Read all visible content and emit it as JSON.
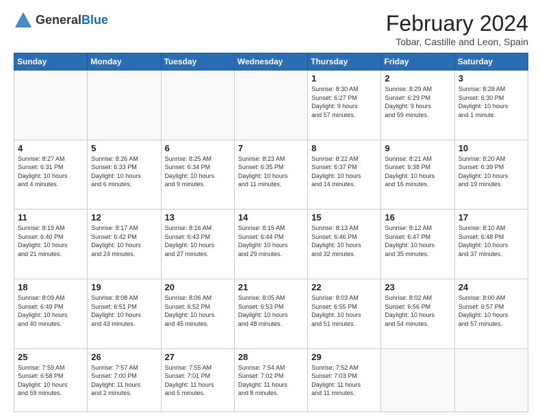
{
  "header": {
    "logo_general": "General",
    "logo_blue": "Blue",
    "month_title": "February 2024",
    "location": "Tobar, Castille and Leon, Spain"
  },
  "days_of_week": [
    "Sunday",
    "Monday",
    "Tuesday",
    "Wednesday",
    "Thursday",
    "Friday",
    "Saturday"
  ],
  "weeks": [
    [
      {
        "day": "",
        "info": ""
      },
      {
        "day": "",
        "info": ""
      },
      {
        "day": "",
        "info": ""
      },
      {
        "day": "",
        "info": ""
      },
      {
        "day": "1",
        "info": "Sunrise: 8:30 AM\nSunset: 6:27 PM\nDaylight: 9 hours\nand 57 minutes."
      },
      {
        "day": "2",
        "info": "Sunrise: 8:29 AM\nSunset: 6:29 PM\nDaylight: 9 hours\nand 59 minutes."
      },
      {
        "day": "3",
        "info": "Sunrise: 8:28 AM\nSunset: 6:30 PM\nDaylight: 10 hours\nand 1 minute."
      }
    ],
    [
      {
        "day": "4",
        "info": "Sunrise: 8:27 AM\nSunset: 6:31 PM\nDaylight: 10 hours\nand 4 minutes."
      },
      {
        "day": "5",
        "info": "Sunrise: 8:26 AM\nSunset: 6:33 PM\nDaylight: 10 hours\nand 6 minutes."
      },
      {
        "day": "6",
        "info": "Sunrise: 8:25 AM\nSunset: 6:34 PM\nDaylight: 10 hours\nand 9 minutes."
      },
      {
        "day": "7",
        "info": "Sunrise: 8:23 AM\nSunset: 6:35 PM\nDaylight: 10 hours\nand 11 minutes."
      },
      {
        "day": "8",
        "info": "Sunrise: 8:22 AM\nSunset: 6:37 PM\nDaylight: 10 hours\nand 14 minutes."
      },
      {
        "day": "9",
        "info": "Sunrise: 8:21 AM\nSunset: 6:38 PM\nDaylight: 10 hours\nand 16 minutes."
      },
      {
        "day": "10",
        "info": "Sunrise: 8:20 AM\nSunset: 6:39 PM\nDaylight: 10 hours\nand 19 minutes."
      }
    ],
    [
      {
        "day": "11",
        "info": "Sunrise: 8:19 AM\nSunset: 6:40 PM\nDaylight: 10 hours\nand 21 minutes."
      },
      {
        "day": "12",
        "info": "Sunrise: 8:17 AM\nSunset: 6:42 PM\nDaylight: 10 hours\nand 24 minutes."
      },
      {
        "day": "13",
        "info": "Sunrise: 8:16 AM\nSunset: 6:43 PM\nDaylight: 10 hours\nand 27 minutes."
      },
      {
        "day": "14",
        "info": "Sunrise: 8:15 AM\nSunset: 6:44 PM\nDaylight: 10 hours\nand 29 minutes."
      },
      {
        "day": "15",
        "info": "Sunrise: 8:13 AM\nSunset: 6:46 PM\nDaylight: 10 hours\nand 32 minutes."
      },
      {
        "day": "16",
        "info": "Sunrise: 8:12 AM\nSunset: 6:47 PM\nDaylight: 10 hours\nand 35 minutes."
      },
      {
        "day": "17",
        "info": "Sunrise: 8:10 AM\nSunset: 6:48 PM\nDaylight: 10 hours\nand 37 minutes."
      }
    ],
    [
      {
        "day": "18",
        "info": "Sunrise: 8:09 AM\nSunset: 6:49 PM\nDaylight: 10 hours\nand 40 minutes."
      },
      {
        "day": "19",
        "info": "Sunrise: 8:08 AM\nSunset: 6:51 PM\nDaylight: 10 hours\nand 43 minutes."
      },
      {
        "day": "20",
        "info": "Sunrise: 8:06 AM\nSunset: 6:52 PM\nDaylight: 10 hours\nand 45 minutes."
      },
      {
        "day": "21",
        "info": "Sunrise: 8:05 AM\nSunset: 6:53 PM\nDaylight: 10 hours\nand 48 minutes."
      },
      {
        "day": "22",
        "info": "Sunrise: 8:03 AM\nSunset: 6:55 PM\nDaylight: 10 hours\nand 51 minutes."
      },
      {
        "day": "23",
        "info": "Sunrise: 8:02 AM\nSunset: 6:56 PM\nDaylight: 10 hours\nand 54 minutes."
      },
      {
        "day": "24",
        "info": "Sunrise: 8:00 AM\nSunset: 6:57 PM\nDaylight: 10 hours\nand 57 minutes."
      }
    ],
    [
      {
        "day": "25",
        "info": "Sunrise: 7:59 AM\nSunset: 6:58 PM\nDaylight: 10 hours\nand 59 minutes."
      },
      {
        "day": "26",
        "info": "Sunrise: 7:57 AM\nSunset: 7:00 PM\nDaylight: 11 hours\nand 2 minutes."
      },
      {
        "day": "27",
        "info": "Sunrise: 7:55 AM\nSunset: 7:01 PM\nDaylight: 11 hours\nand 5 minutes."
      },
      {
        "day": "28",
        "info": "Sunrise: 7:54 AM\nSunset: 7:02 PM\nDaylight: 11 hours\nand 8 minutes."
      },
      {
        "day": "29",
        "info": "Sunrise: 7:52 AM\nSunset: 7:03 PM\nDaylight: 11 hours\nand 11 minutes."
      },
      {
        "day": "",
        "info": ""
      },
      {
        "day": "",
        "info": ""
      }
    ]
  ]
}
